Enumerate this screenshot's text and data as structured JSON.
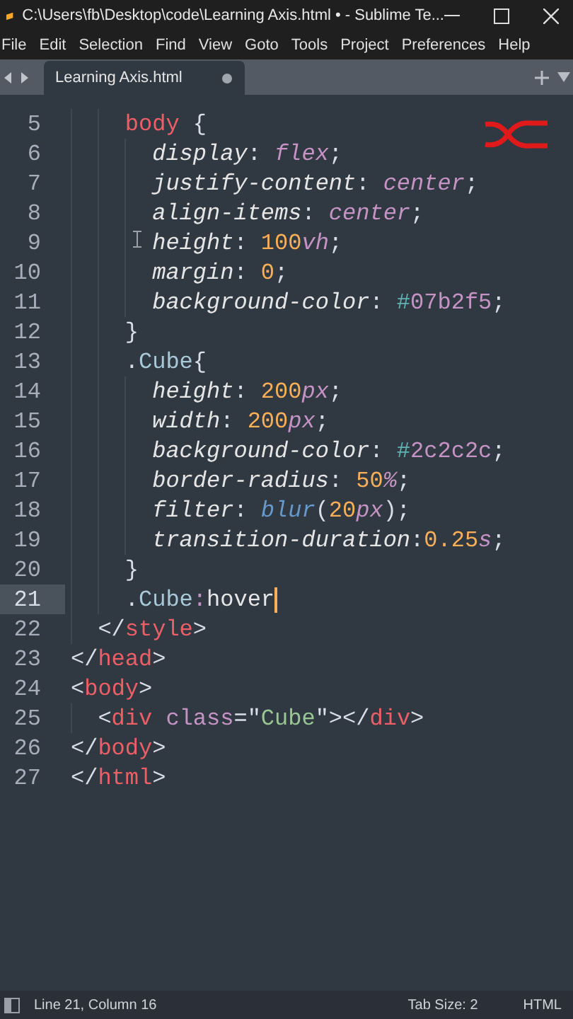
{
  "window": {
    "title": "C:\\Users\\fb\\Desktop\\code\\Learning Axis.html • - Sublime Te..."
  },
  "menu": [
    "File",
    "Edit",
    "Selection",
    "Find",
    "View",
    "Goto",
    "Tools",
    "Project",
    "Preferences",
    "Help"
  ],
  "tabs": [
    {
      "label": "Learning Axis.html",
      "selected": true,
      "modified": true
    }
  ],
  "editor": {
    "lines": [
      {
        "number": "5",
        "current": false,
        "tokens": [
          {
            "text": "    body",
            "kind": "tag"
          },
          {
            "text": " {",
            "kind": "punct"
          }
        ]
      },
      {
        "number": "6",
        "current": false,
        "tokens": [
          {
            "text": "      display",
            "kind": "prop"
          },
          {
            "text": ": ",
            "kind": "punct"
          },
          {
            "text": "flex",
            "kind": "value"
          },
          {
            "text": ";",
            "kind": "punct"
          }
        ]
      },
      {
        "number": "7",
        "current": false,
        "tokens": [
          {
            "text": "      justify-content",
            "kind": "prop"
          },
          {
            "text": ": ",
            "kind": "punct"
          },
          {
            "text": "center",
            "kind": "value"
          },
          {
            "text": ";",
            "kind": "punct"
          }
        ]
      },
      {
        "number": "8",
        "current": false,
        "tokens": [
          {
            "text": "      align-items",
            "kind": "prop"
          },
          {
            "text": ": ",
            "kind": "punct"
          },
          {
            "text": "center",
            "kind": "value"
          },
          {
            "text": ";",
            "kind": "punct"
          }
        ]
      },
      {
        "number": "9",
        "current": false,
        "tokens": [
          {
            "text": "      height",
            "kind": "prop"
          },
          {
            "text": ": ",
            "kind": "punct"
          },
          {
            "text": "100",
            "kind": "number"
          },
          {
            "text": "vh",
            "kind": "unit"
          },
          {
            "text": ";",
            "kind": "punct"
          }
        ]
      },
      {
        "number": "10",
        "current": false,
        "tokens": [
          {
            "text": "      margin",
            "kind": "prop"
          },
          {
            "text": ": ",
            "kind": "punct"
          },
          {
            "text": "0",
            "kind": "number"
          },
          {
            "text": ";",
            "kind": "punct"
          }
        ]
      },
      {
        "number": "11",
        "current": false,
        "tokens": [
          {
            "text": "      background-color",
            "kind": "prop"
          },
          {
            "text": ": ",
            "kind": "punct"
          },
          {
            "text": "#",
            "kind": "hash"
          },
          {
            "text": "07b2f5",
            "kind": "attr"
          },
          {
            "text": ";",
            "kind": "punct"
          }
        ]
      },
      {
        "number": "12",
        "current": false,
        "tokens": [
          {
            "text": "    }",
            "kind": "punct"
          }
        ]
      },
      {
        "number": "13",
        "current": false,
        "tokens": [
          {
            "text": "    .",
            "kind": "punct"
          },
          {
            "text": "Cube",
            "kind": "selector"
          },
          {
            "text": "{",
            "kind": "punct"
          }
        ]
      },
      {
        "number": "14",
        "current": false,
        "tokens": [
          {
            "text": "      height",
            "kind": "prop"
          },
          {
            "text": ": ",
            "kind": "punct"
          },
          {
            "text": "200",
            "kind": "number"
          },
          {
            "text": "px",
            "kind": "unit"
          },
          {
            "text": ";",
            "kind": "punct"
          }
        ]
      },
      {
        "number": "15",
        "current": false,
        "tokens": [
          {
            "text": "      width",
            "kind": "prop"
          },
          {
            "text": ": ",
            "kind": "punct"
          },
          {
            "text": "200",
            "kind": "number"
          },
          {
            "text": "px",
            "kind": "unit"
          },
          {
            "text": ";",
            "kind": "punct"
          }
        ]
      },
      {
        "number": "16",
        "current": false,
        "tokens": [
          {
            "text": "      background-color",
            "kind": "prop"
          },
          {
            "text": ": ",
            "kind": "punct"
          },
          {
            "text": "#",
            "kind": "hash"
          },
          {
            "text": "2c2c2c",
            "kind": "attr"
          },
          {
            "text": ";",
            "kind": "punct"
          }
        ]
      },
      {
        "number": "17",
        "current": false,
        "tokens": [
          {
            "text": "      border-radius",
            "kind": "prop"
          },
          {
            "text": ": ",
            "kind": "punct"
          },
          {
            "text": "50",
            "kind": "number"
          },
          {
            "text": "%",
            "kind": "unit"
          },
          {
            "text": ";",
            "kind": "punct"
          }
        ]
      },
      {
        "number": "18",
        "current": false,
        "tokens": [
          {
            "text": "      filter",
            "kind": "prop"
          },
          {
            "text": ": ",
            "kind": "punct"
          },
          {
            "text": "blur",
            "kind": "func"
          },
          {
            "text": "(",
            "kind": "punct"
          },
          {
            "text": "20",
            "kind": "number"
          },
          {
            "text": "px",
            "kind": "unit"
          },
          {
            "text": ");",
            "kind": "punct"
          }
        ]
      },
      {
        "number": "19",
        "current": false,
        "tokens": [
          {
            "text": "      transition-duration",
            "kind": "prop"
          },
          {
            "text": ":",
            "kind": "punct"
          },
          {
            "text": "0.25",
            "kind": "number"
          },
          {
            "text": "s",
            "kind": "unit"
          },
          {
            "text": ";",
            "kind": "punct"
          }
        ]
      },
      {
        "number": "20",
        "current": false,
        "tokens": [
          {
            "text": "    }",
            "kind": "punct"
          }
        ]
      },
      {
        "number": "21",
        "current": true,
        "tokens": [
          {
            "text": "    .",
            "kind": "punct"
          },
          {
            "text": "Cube",
            "kind": "selector"
          },
          {
            "text": ":",
            "kind": "attr"
          },
          {
            "text": "hover",
            "kind": "plain"
          }
        ]
      },
      {
        "number": "22",
        "current": false,
        "tokens": [
          {
            "text": "  </",
            "kind": "punct"
          },
          {
            "text": "style",
            "kind": "tag"
          },
          {
            "text": ">",
            "kind": "punct"
          }
        ]
      },
      {
        "number": "23",
        "current": false,
        "tokens": [
          {
            "text": "</",
            "kind": "punct"
          },
          {
            "text": "head",
            "kind": "tag"
          },
          {
            "text": ">",
            "kind": "punct"
          }
        ]
      },
      {
        "number": "24",
        "current": false,
        "tokens": [
          {
            "text": "<",
            "kind": "punct"
          },
          {
            "text": "body",
            "kind": "tag"
          },
          {
            "text": ">",
            "kind": "punct"
          }
        ]
      },
      {
        "number": "25",
        "current": false,
        "tokens": [
          {
            "text": "  <",
            "kind": "punct"
          },
          {
            "text": "div",
            "kind": "tag"
          },
          {
            "text": " class",
            "kind": "attr"
          },
          {
            "text": "=\"",
            "kind": "punct"
          },
          {
            "text": "Cube",
            "kind": "string"
          },
          {
            "text": "\"></",
            "kind": "punct"
          },
          {
            "text": "div",
            "kind": "tag"
          },
          {
            "text": ">",
            "kind": "punct"
          }
        ]
      },
      {
        "number": "26",
        "current": false,
        "tokens": [
          {
            "text": "</",
            "kind": "punct"
          },
          {
            "text": "body",
            "kind": "tag"
          },
          {
            "text": ">",
            "kind": "punct"
          }
        ]
      },
      {
        "number": "27",
        "current": false,
        "tokens": [
          {
            "text": "</",
            "kind": "punct"
          },
          {
            "text": "html",
            "kind": "tag"
          },
          {
            "text": ">",
            "kind": "punct"
          }
        ]
      }
    ]
  },
  "status_bar": {
    "position": "Line 21, Column 16",
    "tab_size": "Tab Size: 2",
    "syntax": "HTML"
  }
}
